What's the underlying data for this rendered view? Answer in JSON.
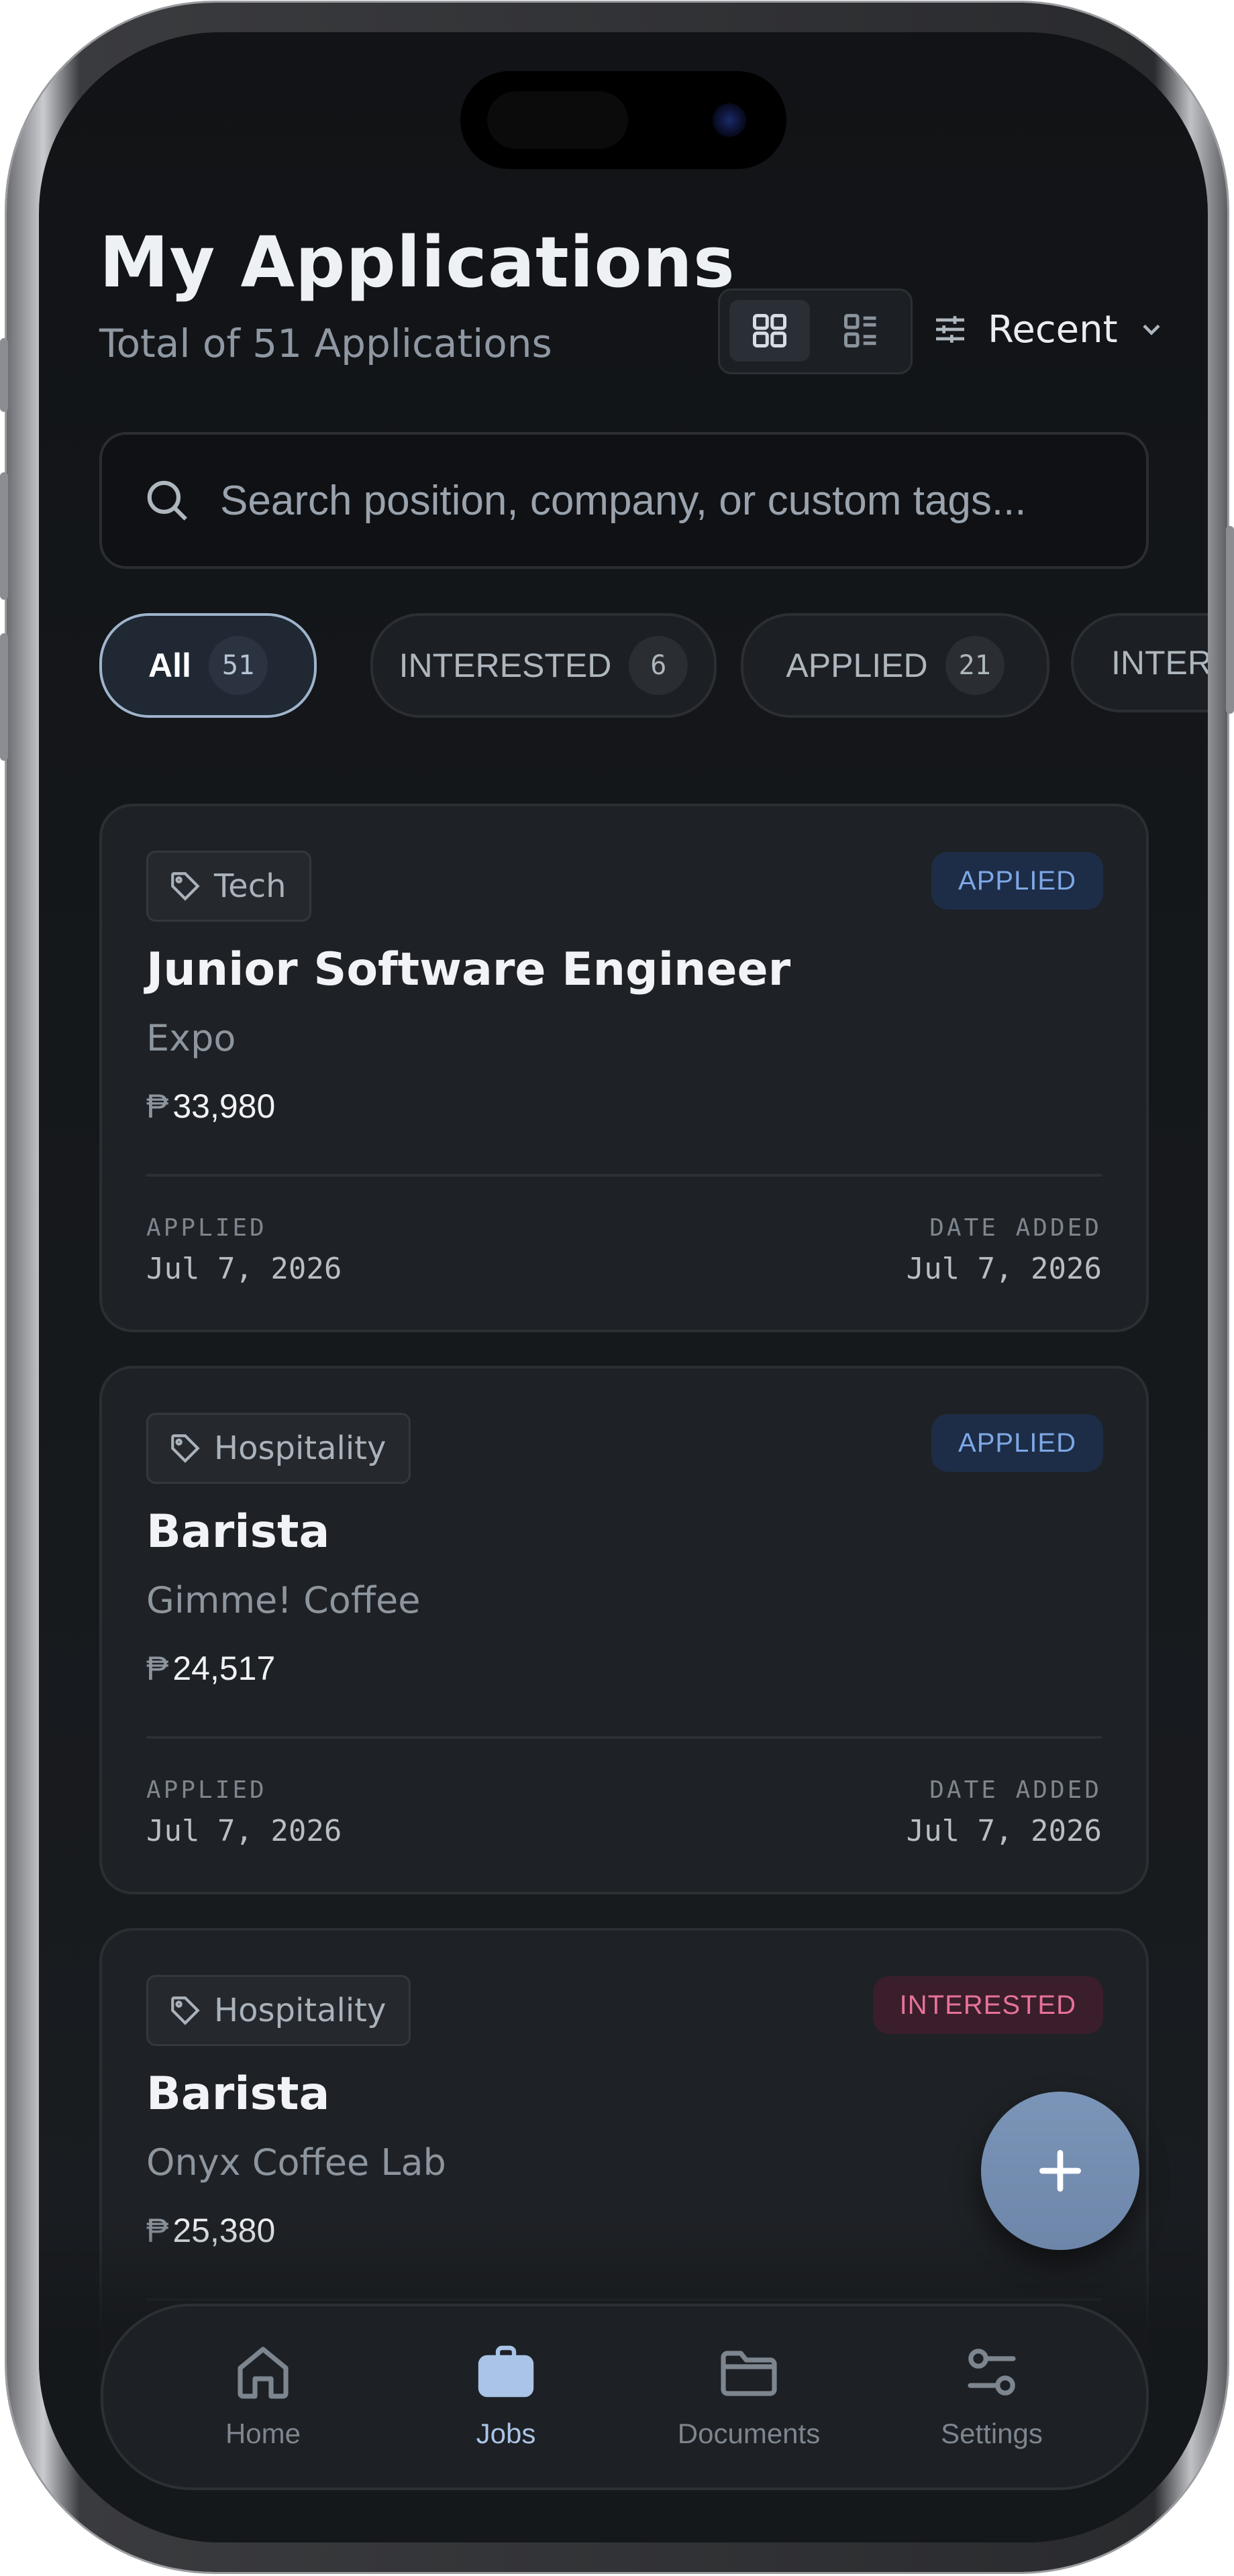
{
  "header": {
    "title": "My Applications",
    "subtitle": "Total of 51 Applications",
    "sort_label": "Recent"
  },
  "view_toggle": {
    "options": [
      "grid-view-icon",
      "list-view-icon"
    ],
    "active": "grid-view-icon"
  },
  "search": {
    "placeholder": "Search position, company, or custom tags..."
  },
  "filters": [
    {
      "label": "All",
      "count": "51",
      "active": true
    },
    {
      "label": "INTERESTED",
      "count": "6",
      "active": false
    },
    {
      "label": "APPLIED",
      "count": "21",
      "active": false
    },
    {
      "label": "INTERVI",
      "count": "",
      "active": false
    }
  ],
  "cards": [
    {
      "tag": "Tech",
      "status": "APPLIED",
      "title": "Junior Software Engineer",
      "company": "Expo",
      "currency": "₱",
      "salary": "33,980",
      "meta_left_label": "APPLIED",
      "meta_left_value": "Jul 7, 2026",
      "meta_right_label": "DATE ADDED",
      "meta_right_value": "Jul 7, 2026"
    },
    {
      "tag": "Hospitality",
      "status": "APPLIED",
      "title": "Barista",
      "company": "Gimme! Coffee",
      "currency": "₱",
      "salary": "24,517",
      "meta_left_label": "APPLIED",
      "meta_left_value": "Jul 7, 2026",
      "meta_right_label": "DATE ADDED",
      "meta_right_value": "Jul 7, 2026"
    },
    {
      "tag": "Hospitality",
      "status": "INTERESTED",
      "title": "Barista",
      "company": "Onyx Coffee Lab",
      "currency": "₱",
      "salary": "25,380"
    }
  ],
  "nav": {
    "items": [
      {
        "label": "Home",
        "icon": "home-icon",
        "active": false
      },
      {
        "label": "Jobs",
        "icon": "briefcase-icon",
        "active": true
      },
      {
        "label": "Documents",
        "icon": "folder-icon",
        "active": false
      },
      {
        "label": "Settings",
        "icon": "sliders-icon",
        "active": false
      }
    ]
  },
  "colors": {
    "background": "#15181b",
    "card": "#1e2125",
    "accent": "#a9c4e6",
    "applied": "#7ea8e6",
    "interested": "#e7729a",
    "fab": "#7b95b8"
  }
}
